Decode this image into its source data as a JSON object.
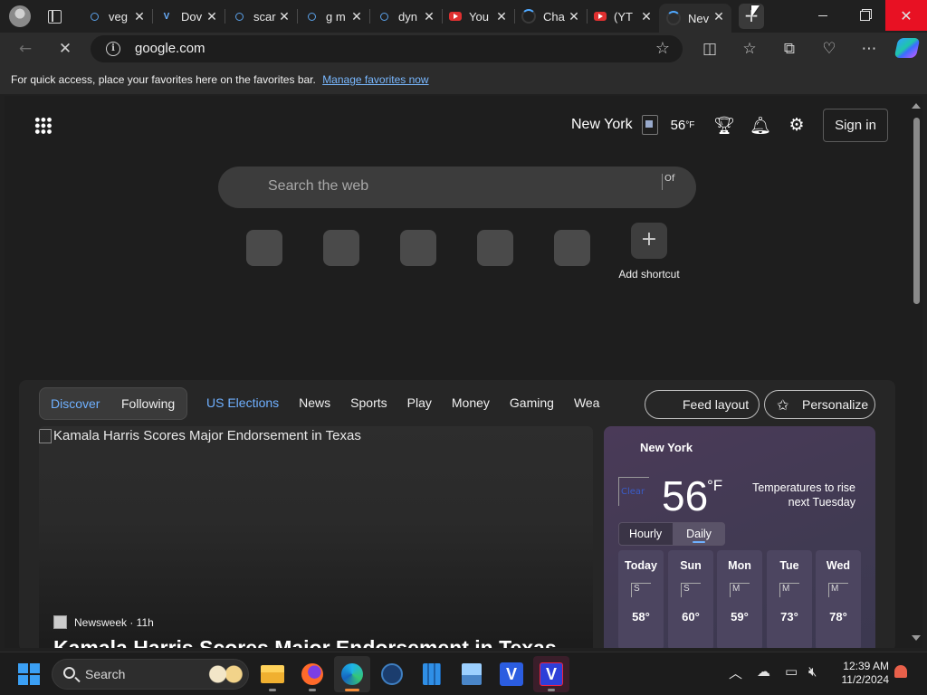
{
  "tabs": [
    {
      "favicon": "search-icon",
      "title": "veg"
    },
    {
      "favicon": "v-logo-icon",
      "title": "Dov"
    },
    {
      "favicon": "search-icon",
      "title": "scar"
    },
    {
      "favicon": "search-icon",
      "title": "g m"
    },
    {
      "favicon": "search-icon",
      "title": "dyn"
    },
    {
      "favicon": "youtube-icon",
      "title": "You"
    },
    {
      "favicon": "loading-spinner-icon",
      "title": "Cha"
    },
    {
      "favicon": "youtube-icon",
      "title": "(YT"
    },
    {
      "favicon": "loading-spinner-icon",
      "title": "Nev",
      "active": true
    }
  ],
  "address": {
    "url": "google.com"
  },
  "favorites_bar": {
    "message": "For quick access, place your favorites here on the favorites bar.",
    "link": "Manage favorites now"
  },
  "header": {
    "city": "New York",
    "temp": "56",
    "unit": "°F",
    "sign_in": "Sign in"
  },
  "search": {
    "placeholder": "Search the web",
    "visual_search_alt": "Of"
  },
  "shortcuts": {
    "add_label": "Add shortcut"
  },
  "feed": {
    "discover": "Discover",
    "following": "Following",
    "tabs": [
      "US Elections",
      "News",
      "Sports",
      "Play",
      "Money",
      "Gaming",
      "Wea"
    ],
    "feed_layout": "Feed layout",
    "personalize": "Personalize"
  },
  "hero": {
    "image_alt": "Kamala Harris Scores Major Endorsement in Texas",
    "source": "Newsweek · 11h",
    "headline": "Kamala Harris Scores Major Endorsement in Texas"
  },
  "weather_card": {
    "city": "New York",
    "condition_alt": "Clear",
    "temp": "56",
    "unit": "°F",
    "forecast": "Temperatures to rise next Tuesday",
    "hourly": "Hourly",
    "daily": "Daily",
    "days": [
      {
        "name": "Today",
        "icon": "S",
        "high": "58°"
      },
      {
        "name": "Sun",
        "icon": "S",
        "high": "60°"
      },
      {
        "name": "Mon",
        "icon": "M",
        "high": "59°"
      },
      {
        "name": "Tue",
        "icon": "M",
        "high": "73°"
      },
      {
        "name": "Wed",
        "icon": "M",
        "high": "78°"
      }
    ]
  },
  "taskbar": {
    "search_label": "Search",
    "time": "12:39 AM",
    "date": "11/2/2024"
  },
  "colors": {
    "accent": "#6fb0ff",
    "close_red": "#e81123",
    "weather_bg": "#4a3a58"
  }
}
